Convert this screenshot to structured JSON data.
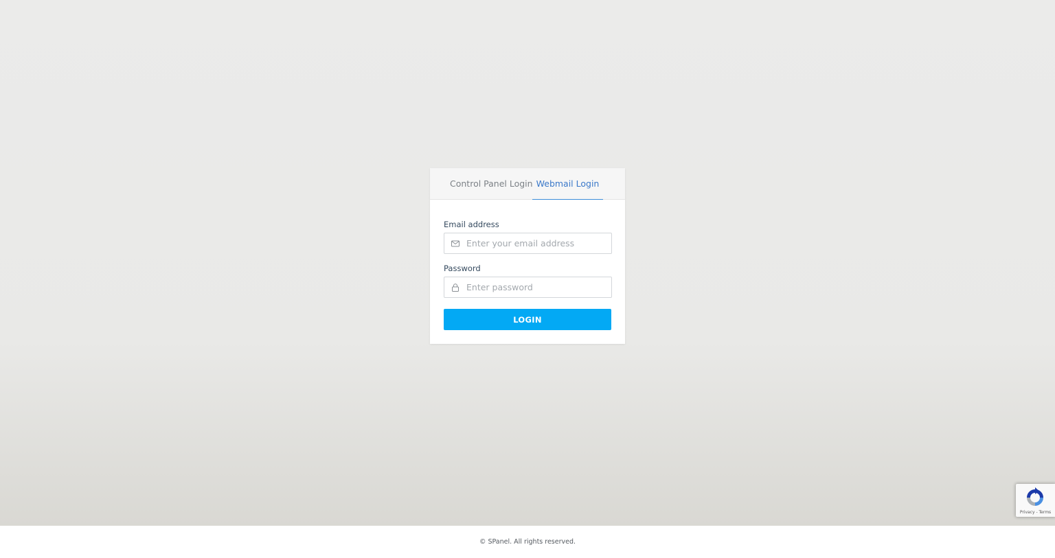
{
  "tabs": [
    {
      "label": "Control Panel Login",
      "active": false
    },
    {
      "label": "Webmail Login",
      "active": true
    }
  ],
  "form": {
    "email": {
      "label": "Email address",
      "placeholder": "Enter your email address",
      "value": "",
      "icon": "envelope-icon"
    },
    "password": {
      "label": "Password",
      "placeholder": "Enter password",
      "value": "",
      "icon": "lock-icon"
    },
    "submit_label": "LOGIN"
  },
  "footer": {
    "copyright": "© SPanel. All rights reserved."
  },
  "recaptcha": {
    "terms": "Privacy - Terms",
    "icon": "recaptcha-icon"
  },
  "colors": {
    "accent": "#03a9f4",
    "active_tab": "#3a78c9",
    "label": "#34495e"
  }
}
